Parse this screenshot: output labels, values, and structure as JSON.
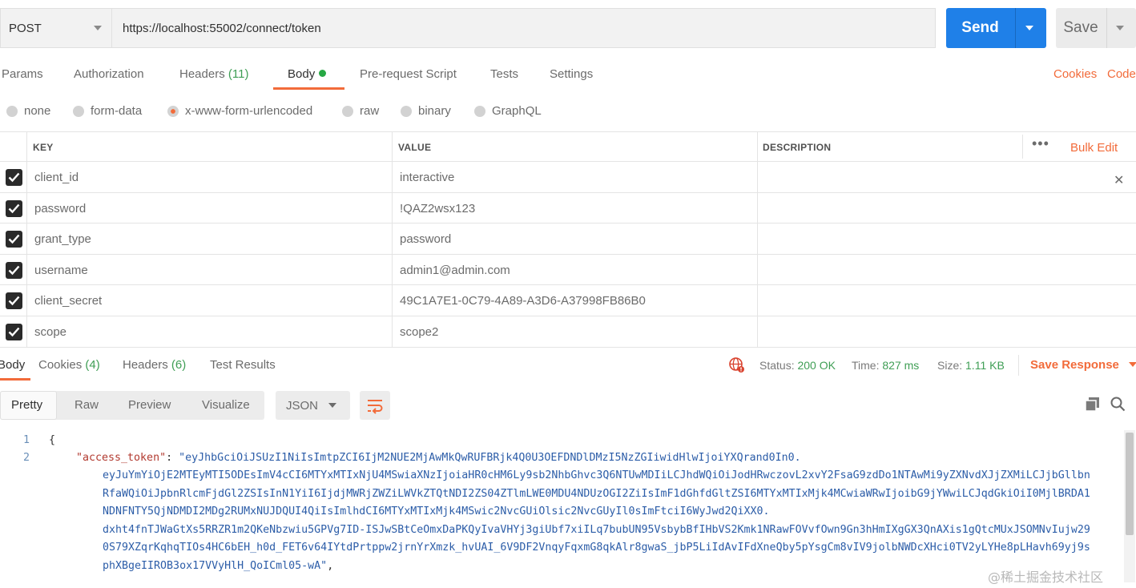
{
  "request": {
    "method": "POST",
    "url": "https://localhost:55002/connect/token",
    "send_label": "Send",
    "save_label": "Save"
  },
  "tabs": [
    {
      "label": "Params"
    },
    {
      "label": "Authorization"
    },
    {
      "label": "Headers",
      "count": "(11)"
    },
    {
      "label": "Body"
    },
    {
      "label": "Pre-request Script"
    },
    {
      "label": "Tests"
    },
    {
      "label": "Settings"
    }
  ],
  "links": {
    "cookies": "Cookies",
    "code": "Code"
  },
  "body_types": [
    "none",
    "form-data",
    "x-www-form-urlencoded",
    "raw",
    "binary",
    "GraphQL"
  ],
  "table": {
    "headers": {
      "key": "KEY",
      "value": "VALUE",
      "description": "DESCRIPTION"
    },
    "bulk_edit": "Bulk Edit",
    "rows": [
      {
        "key": "client_id",
        "value": "interactive"
      },
      {
        "key": "password",
        "value": "!QAZ2wsx123"
      },
      {
        "key": "grant_type",
        "value": "password"
      },
      {
        "key": "username",
        "value": "admin1@admin.com"
      },
      {
        "key": "client_secret",
        "value": "49C1A7E1-0C79-4A89-A3D6-A37998FB86B0"
      },
      {
        "key": "scope",
        "value": "scope2"
      }
    ]
  },
  "response": {
    "tabs": [
      {
        "label": "Body"
      },
      {
        "label": "Cookies",
        "count": "(4)"
      },
      {
        "label": "Headers",
        "count": "(6)"
      },
      {
        "label": "Test Results"
      }
    ],
    "status_label": "Status:",
    "status": "200 OK",
    "time_label": "Time:",
    "time": "827 ms",
    "size_label": "Size:",
    "size": "1.11 KB",
    "save_response": "Save Response",
    "view_tabs": [
      "Pretty",
      "Raw",
      "Preview",
      "Visualize"
    ],
    "format": "JSON",
    "code": {
      "line1_num": "1",
      "line1": "{",
      "line2_num": "2",
      "key": "\"access_token\"",
      "colon": ": ",
      "token_lines": [
        "\"eyJhbGciOiJSUzI1NiIsImtpZCI6IjM2NUE2MjAwMkQwRUFBRjk4Q0U3OEFDNDlDMzI5NzZGIiwidHlwIjoiYXQrand0In0.",
        "eyJuYmYiOjE2MTEyMTI5ODEsImV4cCI6MTYxMTIxNjU4MSwiaXNzIjoiaHR0cHM6Ly9sb2NhbGhvc3Q6NTUwMDIiLCJhdWQiOiJodHRwczovL2xvY2FsaG9zdDo1NTAwMi9yZXNvdXJjZXMiLCJjbGllbn",
        "RfaWQiOiJpbnRlcmFjdGl2ZSIsInN1YiI6IjdjMWRjZWZiLWVkZTQtNDI2ZS04ZTlmLWE0MDU4NDUzOGI2ZiIsImF1dGhfdGltZSI6MTYxMTIxMjk4MCwiaWRwIjoibG9jYWwiLCJqdGkiOiI0MjlBRDA1",
        "NDNFNTY5QjNDMDI2MDg2RUMxNUJDQUI4QiIsImlhdCI6MTYxMTIxMjk4MSwic2NvcGUiOlsic2NvcGUyIl0sImFtciI6WyJwd2QiXX0.",
        "dxht4fnTJWaGtXs5RRZR1m2QKeNbzwiu5GPVg7ID-ISJwSBtCeOmxDaPKQyIvaVHYj3giUbf7xiILq7bubUN95VsbybBfIHbVS2Kmk1NRawFOVvfOwn9Gn3hHmIXgGX3QnAXis1gQtcMUxJSOMNvIujw29",
        "0S79XZqrKqhqTIOs4HC6bEH_h0d_FET6v64IYtdPrtppw2jrnYrXmzk_hvUAI_6V9DF2VnqyFqxmG8qkAlr8gwaS_jbP5LiIdAvIFdXneQby5pYsgCm8vIV9jolbNWDcXHci0TV2yLYHe8pLHavh69yj9s",
        "phXBgeIIROB3ox17VVyHlH_QoICml05-wA\""
      ],
      "trailing": ","
    }
  },
  "watermark": "@稀土掘金技术社区",
  "icons": {
    "check": "checkmark-icon",
    "close": "close-icon",
    "more": "more-horizontal-icon",
    "globe": "globe-warning-icon",
    "wrap": "wrap-lines-icon",
    "copy": "copy-icon",
    "search": "search-icon"
  }
}
